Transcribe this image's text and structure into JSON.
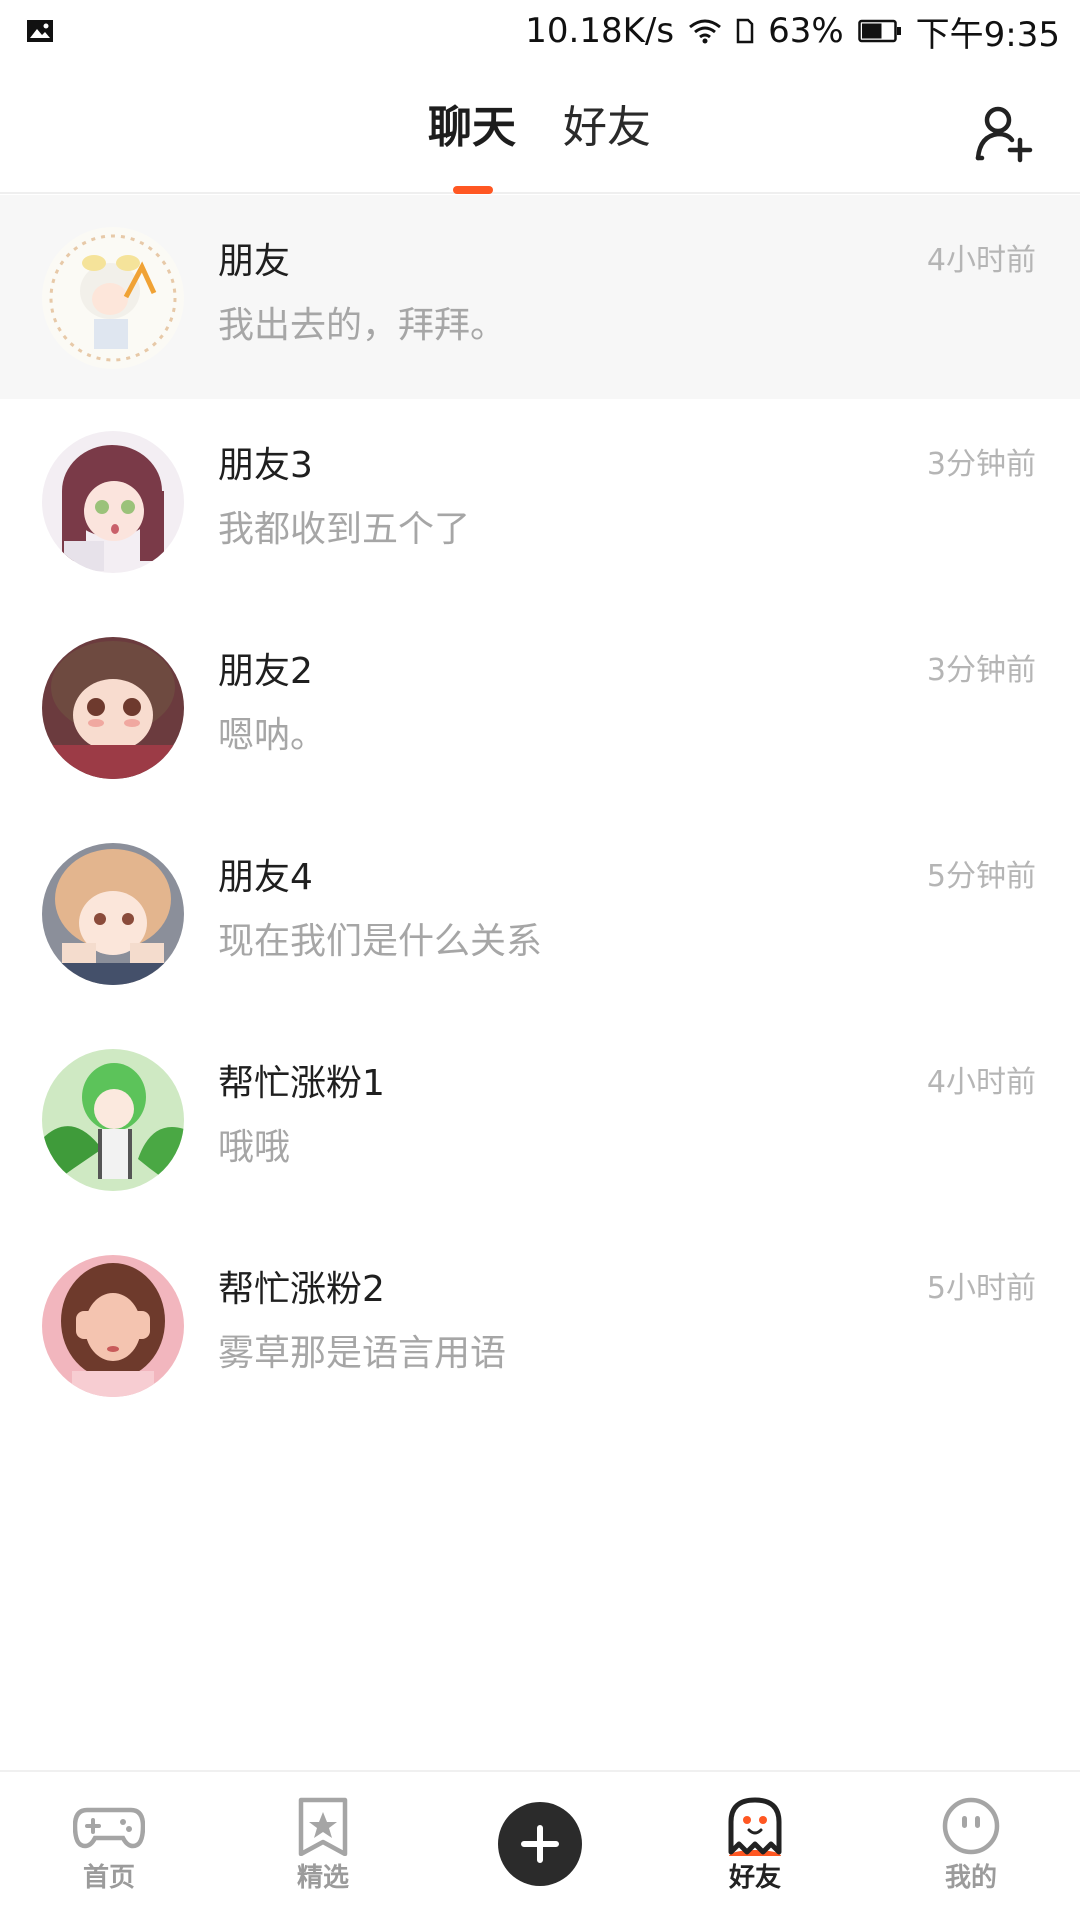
{
  "status_bar": {
    "network_speed": "10.18K/s",
    "battery_percent": "63%",
    "time": "下午9:35",
    "battery_level": 0.63
  },
  "header": {
    "tabs": [
      {
        "label": "聊天",
        "active": true
      },
      {
        "label": "好友",
        "active": false
      }
    ],
    "accent_color": "#ff5722"
  },
  "chats": [
    {
      "name": "朋友",
      "message": "我出去的，拜拜。",
      "time": "4小时前"
    },
    {
      "name": "朋友3",
      "message": "我都收到五个了",
      "time": "3分钟前"
    },
    {
      "name": "朋友2",
      "message": "嗯呐。",
      "time": "3分钟前"
    },
    {
      "name": "朋友4",
      "message": "现在我们是什么关系",
      "time": "5分钟前"
    },
    {
      "name": "帮忙涨粉1",
      "message": "哦哦",
      "time": "4小时前"
    },
    {
      "name": "帮忙涨粉2",
      "message": "雾草那是语言用语",
      "time": "5小时前"
    }
  ],
  "bottom_nav": {
    "items": [
      {
        "label": "首页",
        "icon": "gamepad-icon"
      },
      {
        "label": "精选",
        "icon": "star-bookmark-icon"
      },
      {
        "label": "",
        "icon": "plus-icon"
      },
      {
        "label": "好友",
        "icon": "ghost-icon"
      },
      {
        "label": "我的",
        "icon": "face-icon"
      }
    ]
  }
}
